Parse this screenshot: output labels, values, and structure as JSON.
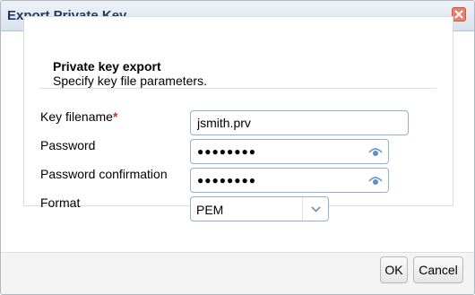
{
  "dialog": {
    "title": "Export Private Key",
    "close_icon": "close-icon"
  },
  "section": {
    "title": "Private key export",
    "subtitle": "Specify key file parameters."
  },
  "fields": {
    "key_filename": {
      "label": "Key filename",
      "required_mark": "*",
      "value": "jsmith.prv"
    },
    "password": {
      "label": "Password",
      "masked_value": "●●●●●●●●",
      "icon": "eye-icon"
    },
    "password_confirmation": {
      "label": "Password confirmation",
      "masked_value": "●●●●●●●●",
      "icon": "eye-icon"
    },
    "format": {
      "label": "Format",
      "value": "PEM",
      "icon": "chevron-down-icon"
    }
  },
  "buttons": {
    "ok": "OK",
    "cancel": "Cancel"
  },
  "colors": {
    "title_text": "#1e3a5c",
    "required": "#c0392b",
    "field_border": "#8fb2d6",
    "eye_icon": "#5b8fc7"
  }
}
